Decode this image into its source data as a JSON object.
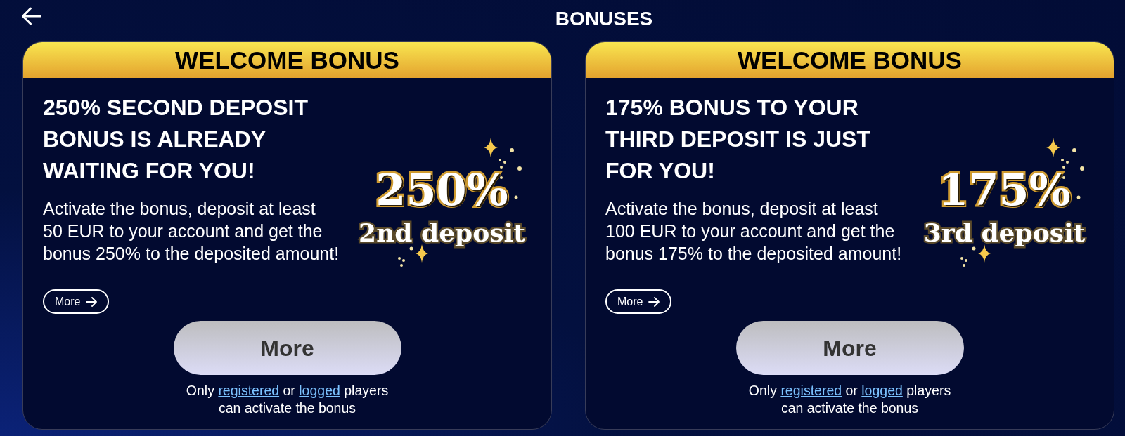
{
  "header": {
    "title": "BONUSES"
  },
  "cards": [
    {
      "ribbon": "WELCOME BONUS",
      "headline": "250% SECOND DEPOSIT\nBONUS IS ALREADY\nWAITING FOR YOU!",
      "description": "Activate the bonus, deposit at least\n50 EUR to your account and get the\nbonus 250% to the deposited amount!",
      "graphic": {
        "percent": "250%",
        "label": "2nd deposit"
      },
      "more_link": "More",
      "action_button": "More",
      "notice": [
        {
          "kind": "text",
          "text": "Only"
        },
        {
          "kind": "link",
          "text": "registered"
        },
        {
          "kind": "text",
          "text": "or"
        },
        {
          "kind": "link",
          "text": "logged"
        },
        {
          "kind": "text",
          "text": "players can activate the bonus"
        }
      ]
    },
    {
      "ribbon": "WELCOME BONUS",
      "headline": "175% BONUS TO YOUR\nTHIRD DEPOSIT IS JUST\nFOR YOU!",
      "description": "Activate the bonus, deposit at least\n100 EUR to your account and get the\nbonus 175% to the deposited amount!",
      "graphic": {
        "percent": "175%",
        "label": "3rd deposit"
      },
      "more_link": "More",
      "action_button": "More",
      "notice": [
        {
          "kind": "text",
          "text": "Only"
        },
        {
          "kind": "link",
          "text": "registered"
        },
        {
          "kind": "text",
          "text": "or"
        },
        {
          "kind": "link",
          "text": "logged"
        },
        {
          "kind": "text",
          "text": "players can activate the bonus"
        }
      ]
    }
  ]
}
